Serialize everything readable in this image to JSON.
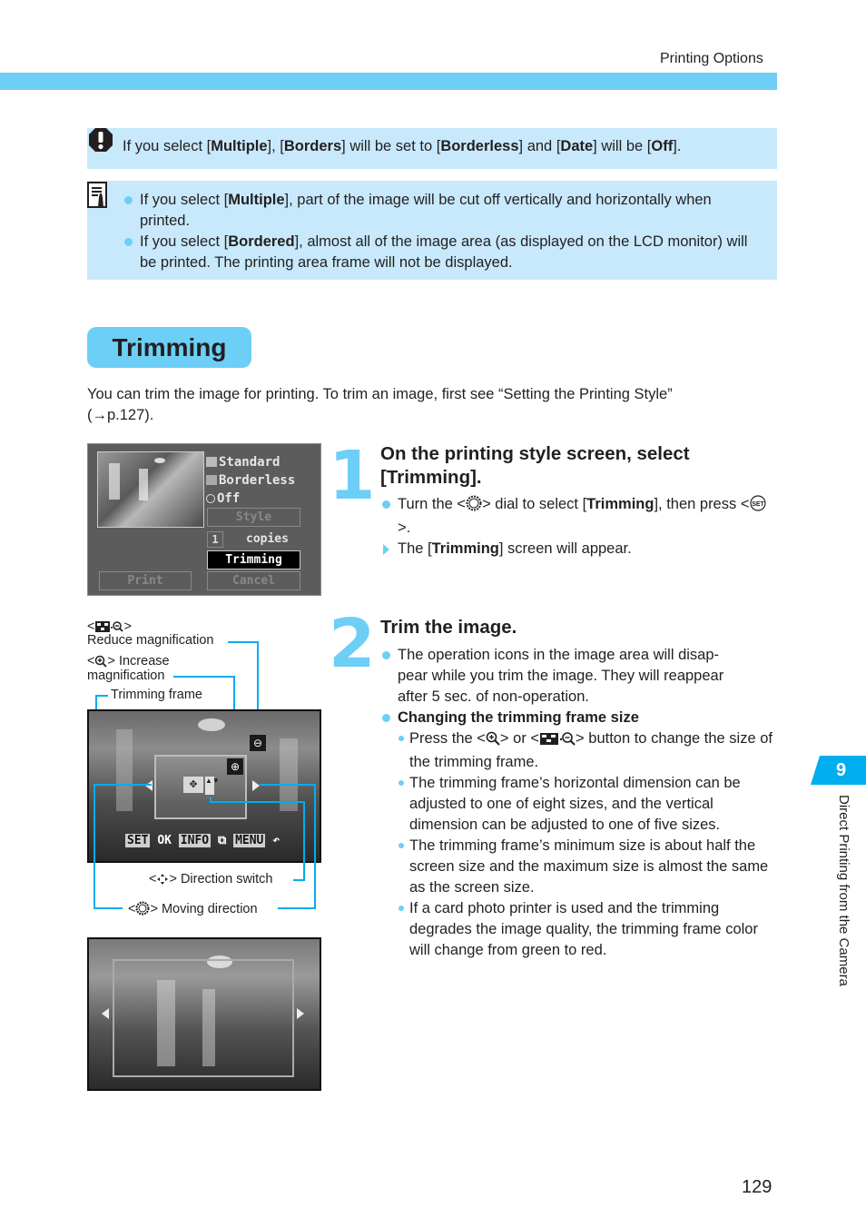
{
  "header": {
    "section_label": "Printing Options"
  },
  "caution": {
    "icon": "caution-icon",
    "parts": [
      "If you select [",
      "Multiple",
      "], [",
      "Borders",
      "] will be set to [",
      "Borderless",
      "] and [",
      "Date",
      "] will be [",
      "Off",
      "]."
    ]
  },
  "memo": {
    "icon": "memo-icon",
    "items": [
      {
        "pre": "If you select [",
        "bold": "Multiple",
        "post": "], part of the image will be cut off vertically and horizontally when printed."
      },
      {
        "pre": "If you select [",
        "bold": "Bordered",
        "post": "], almost all of the image area (as displayed on the LCD monitor) will be printed. The printing area frame will not be displayed."
      }
    ]
  },
  "section": {
    "title": "Trimming",
    "intro": "You can trim the image for printing. To trim an image, first see “Setting the Printing Style” (→p.127)."
  },
  "screen1": {
    "options": [
      "Standard",
      "Borderless",
      "Off"
    ],
    "style_button": "Style",
    "copies_value": "1",
    "copies_label": "copies",
    "trimming_button": "Trimming",
    "print_button": "Print",
    "cancel_button": "Cancel"
  },
  "step1": {
    "number": "1",
    "heading": "On the printing style screen, select [Trimming].",
    "bullet1": {
      "pre": "Turn the <",
      "icon": "main-dial-icon",
      "mid": "> dial to select [",
      "bold": "Trimming",
      "post": "], then press <",
      "icon2": "set-button-icon",
      "end": ">."
    },
    "result": {
      "pre": "The [",
      "bold": "Trimming",
      "post": "] screen will appear."
    }
  },
  "callouts": {
    "reduce_prefix": "<",
    "reduce_suffix": ">",
    "reduce_label": "Reduce magnification",
    "increase_label": "> Increase",
    "increase_label2": "magnification",
    "frame_label": "Trimming frame",
    "direction_switch_label": "> Direction switch",
    "moving_direction_label": "> Moving direction",
    "lt": "<"
  },
  "screen2": {
    "bottom_bar": [
      "SET",
      "OK",
      "INFO",
      "MENU"
    ]
  },
  "step2": {
    "number": "2",
    "heading": "Trim the image.",
    "bullet1": "The operation icons in the image area will disappear while you trim the image. They will reappear after 5 sec. of non-operation.",
    "bullet1_lines": [
      "The operation icons in the image area will disap-",
      "pear while you trim the image. They will reappear",
      "after 5 sec. of non-operation."
    ],
    "subheading": "Changing the trimming frame size",
    "sub_items": [
      {
        "pre": "Press the <",
        "mid": "> or <",
        "post": "> button to change the size of the trimming frame."
      },
      {
        "text": "The trimming frame’s horizontal dimension can be adjusted to one of eight sizes, and the vertical dimension can be adjusted to one of five sizes."
      },
      {
        "text": "The trimming frame’s minimum size is about half the screen size and the maximum size is almost the same as the screen size."
      },
      {
        "text": "If a card photo printer is used and the trimming degrades the image quality, the trimming frame color will change from green to red."
      }
    ]
  },
  "chapter": {
    "number": "9",
    "label": "Direct Printing from the Camera",
    "color": "#00aeef"
  },
  "accent_color": "#6dcff6",
  "page_number": "129"
}
